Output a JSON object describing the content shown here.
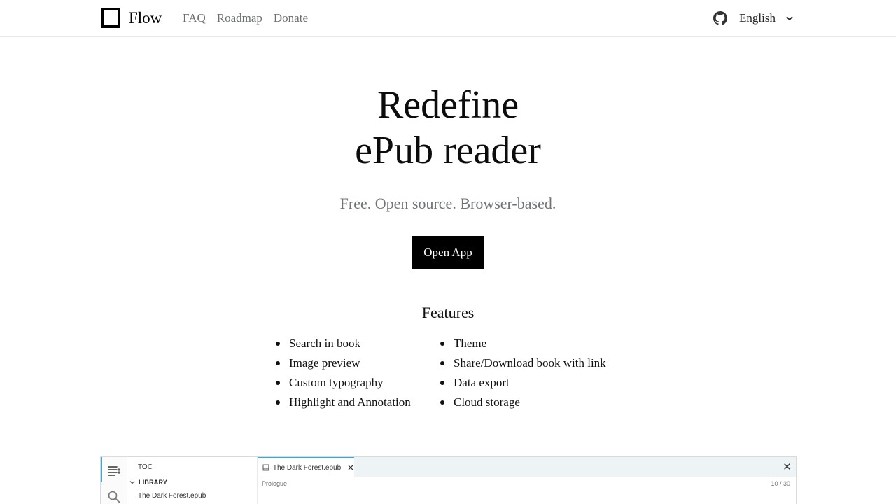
{
  "header": {
    "brand": "Flow",
    "nav": [
      "FAQ",
      "Roadmap",
      "Donate"
    ],
    "language": "English",
    "icons": {
      "github": "github-icon",
      "chevron": "chevron-down-icon"
    }
  },
  "hero": {
    "title_line1": "Redefine",
    "title_line2": "ePub reader",
    "subtitle": "Free. Open source. Browser-based.",
    "cta": "Open App"
  },
  "features": {
    "title": "Features",
    "left": [
      "Search in book",
      "Image preview",
      "Custom typography",
      "Highlight and Annotation"
    ],
    "right": [
      "Theme",
      "Share/Download book with link",
      "Data export",
      "Cloud storage"
    ]
  },
  "preview": {
    "toc": "TOC",
    "library": "LIBRARY",
    "book": "The Dark Forest.epub",
    "tab": "The Dark Forest.epub",
    "chapter": "Prologue",
    "page": "10 / 30",
    "accent": "#4aa3c9"
  }
}
